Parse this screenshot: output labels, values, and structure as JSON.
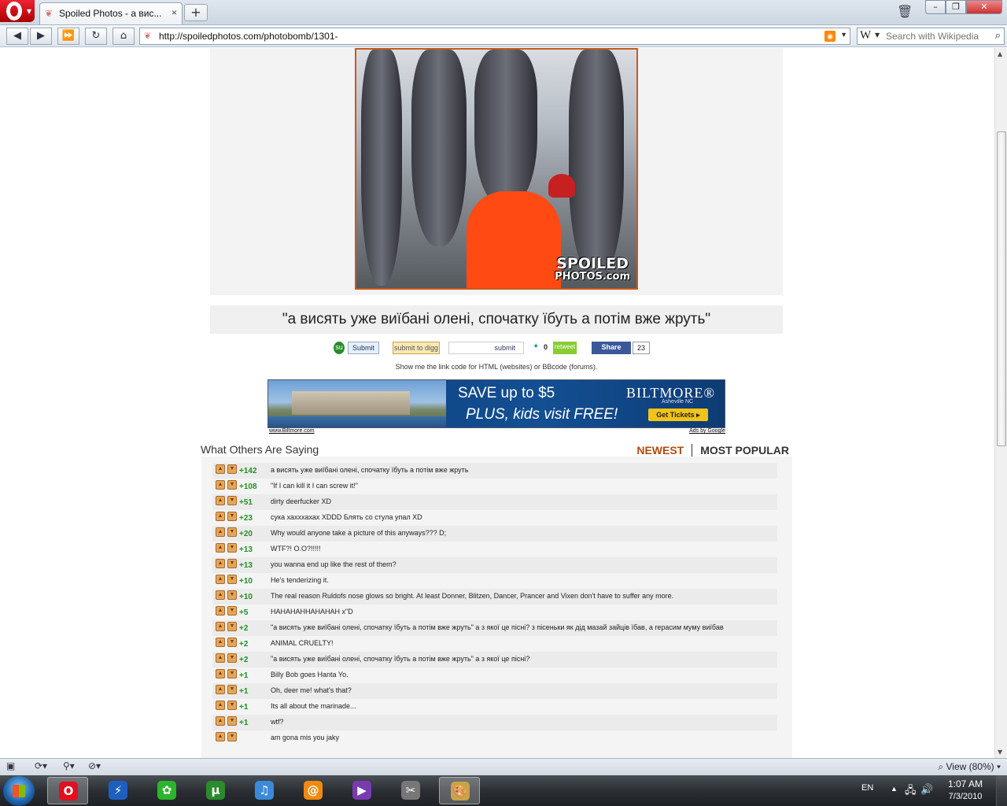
{
  "browser": {
    "tab_title": "Spoiled Photos - а вис...",
    "tab_close": "×",
    "new_tab": "+",
    "url": "http://spoiledphotos.com/photobomb/1301-",
    "search_placeholder": "Search with Wikipedia",
    "search_engine_glyph": "W",
    "nav": {
      "back": "◀",
      "forward": "▶",
      "fast_forward": "⏩",
      "reload": "↻",
      "home": "⌂"
    },
    "window_buttons": {
      "min": "–",
      "max": "❐",
      "close": "✕"
    }
  },
  "page": {
    "watermark_line1": "SPOILED",
    "watermark_line2": "PHOTOS.com",
    "caption": "\"а висять уже виїбані олені, спочатку їбуть а потім вже жруть\"",
    "share": {
      "stumble_label": "Submit",
      "digg_label": "submit to digg",
      "reddit_label": "submit",
      "tweet_count": "0",
      "retweet_label": "retweet",
      "facebook_label": "Share",
      "facebook_count": "23"
    },
    "link_code_text": "Show me the link code for HTML (websites) or BBcode (forums).",
    "ad": {
      "line1": "SAVE up to $5",
      "line2": "PLUS, kids visit FREE!",
      "brand": "BILTMORE®",
      "location": "Asheville NC",
      "cta": "Get Tickets ▸",
      "footer_left": "www.Biltmore.com",
      "footer_right": "Ads by Google"
    },
    "comments_heading": "What Others Are Saying",
    "sort_newest": "NEWEST",
    "sort_popular": "MOST POPULAR",
    "comments": [
      {
        "score": "+142",
        "text": "а висять уже виїбані олені, спочатку їбуть а потім вже жруть"
      },
      {
        "score": "+108",
        "text": "\"If I can kill it I can screw it!\""
      },
      {
        "score": "+51",
        "text": "dirty deerfucker XD"
      },
      {
        "score": "+23",
        "text": "сука хахххахах XDDD Блять со стула упал XD"
      },
      {
        "score": "+20",
        "text": "Why would anyone take a picture of this anyways??? D;"
      },
      {
        "score": "+13",
        "text": "WTF?! O.O?!!!!!"
      },
      {
        "score": "+13",
        "text": "you wanna end up like the rest of them?"
      },
      {
        "score": "+10",
        "text": "He's tenderizing it."
      },
      {
        "score": "+10",
        "text": "The real reason Ruldofs nose glows so bright. At least Donner, Blitzen, Dancer, Prancer and Vixen don't have to suffer any more."
      },
      {
        "score": "+5",
        "text": "HAHAHAHHAHAHAH x\"D"
      },
      {
        "score": "+2",
        "text": "\"а висять уже виїбані олені, спочатку їбуть а потім вже жруть\" а з якої це пісні? з пісеньки як дід мазай зайців їбав, а герасим муму виїбав"
      },
      {
        "score": "+2",
        "text": "ANIMAL CRUELTY!"
      },
      {
        "score": "+2",
        "text": "\"а висять уже виїбані олені, спочатку їбуть а потім вже жруть\" а з якої це пісні?"
      },
      {
        "score": "+1",
        "text": "Billy Bob goes Hanta Yo."
      },
      {
        "score": "+1",
        "text": "Oh, deer me! what's that?"
      },
      {
        "score": "+1",
        "text": "Its all about the marinade..."
      },
      {
        "score": "+1",
        "text": "wtf?"
      },
      {
        "score": "",
        "text": "am gona mis you jaky"
      }
    ]
  },
  "statusbar": {
    "zoom_label": "View (80%)"
  },
  "taskbar": {
    "apps": [
      {
        "name": "opera",
        "glyph": "O",
        "color": "#e0101e",
        "active": true
      },
      {
        "name": "flashget",
        "glyph": "⚡",
        "color": "#1c5fbf",
        "active": false
      },
      {
        "name": "icq",
        "glyph": "✿",
        "color": "#2bb52b",
        "active": false
      },
      {
        "name": "utorrent",
        "glyph": "µ",
        "color": "#2b8a2b",
        "active": false
      },
      {
        "name": "itunes",
        "glyph": "♫",
        "color": "#3b8ad8",
        "active": false
      },
      {
        "name": "qip",
        "glyph": "@",
        "color": "#f08a10",
        "active": false
      },
      {
        "name": "mp4-converter",
        "glyph": "▶",
        "color": "#7a3ab0",
        "active": false
      },
      {
        "name": "video-editor",
        "glyph": "✂",
        "color": "#777777",
        "active": false
      },
      {
        "name": "paint",
        "glyph": "🎨",
        "color": "#c7a34a",
        "active": true
      }
    ],
    "language": "EN",
    "time": "1:07 AM",
    "date": "7/3/2010"
  }
}
